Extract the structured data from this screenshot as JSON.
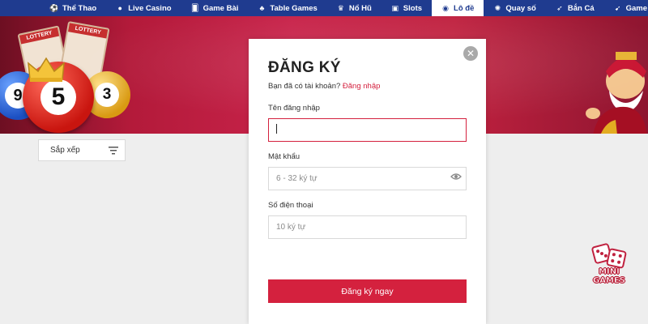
{
  "nav": {
    "items": [
      {
        "label": "Thể Thao",
        "icon": "soccer-icon"
      },
      {
        "label": "Live Casino",
        "icon": "live-casino-icon"
      },
      {
        "label": "Game Bài",
        "icon": "cards-icon"
      },
      {
        "label": "Table Games",
        "icon": "table-games-icon"
      },
      {
        "label": "Nổ Hũ",
        "icon": "jackpot-icon"
      },
      {
        "label": "Slots",
        "icon": "slots-icon"
      },
      {
        "label": "Lô đề",
        "icon": "lottery-ball-icon",
        "active": true
      },
      {
        "label": "Quay số",
        "icon": "wheel-icon"
      },
      {
        "label": "Bắn Cá",
        "icon": "fish-icon"
      },
      {
        "label": "Game Nh",
        "icon": "rocket-icon"
      }
    ]
  },
  "banner": {
    "ticket_label": "LOTTERY",
    "balls": [
      "9",
      "5",
      "3"
    ]
  },
  "sort": {
    "label": "Sắp xếp",
    "icon": "filter-lines-icon"
  },
  "modal": {
    "title": "ĐĂNG KÝ",
    "have_account": "Bạn đã có tài khoản?",
    "login_link": "Đăng nhập",
    "username_label": "Tên đăng nhập",
    "username_value": "",
    "password_label": "Mật khẩu",
    "password_placeholder": "6 - 32 ký tự",
    "phone_label": "Số điện thoại",
    "phone_placeholder": "10 ký tự",
    "submit_label": "Đăng ký ngay",
    "close_icon": "close-icon"
  },
  "minigames": {
    "line1": "MINI",
    "line2": "GAMES"
  },
  "colors": {
    "nav": "#1f3b8f",
    "accent": "#d4213e",
    "banner": "#c8234a"
  }
}
